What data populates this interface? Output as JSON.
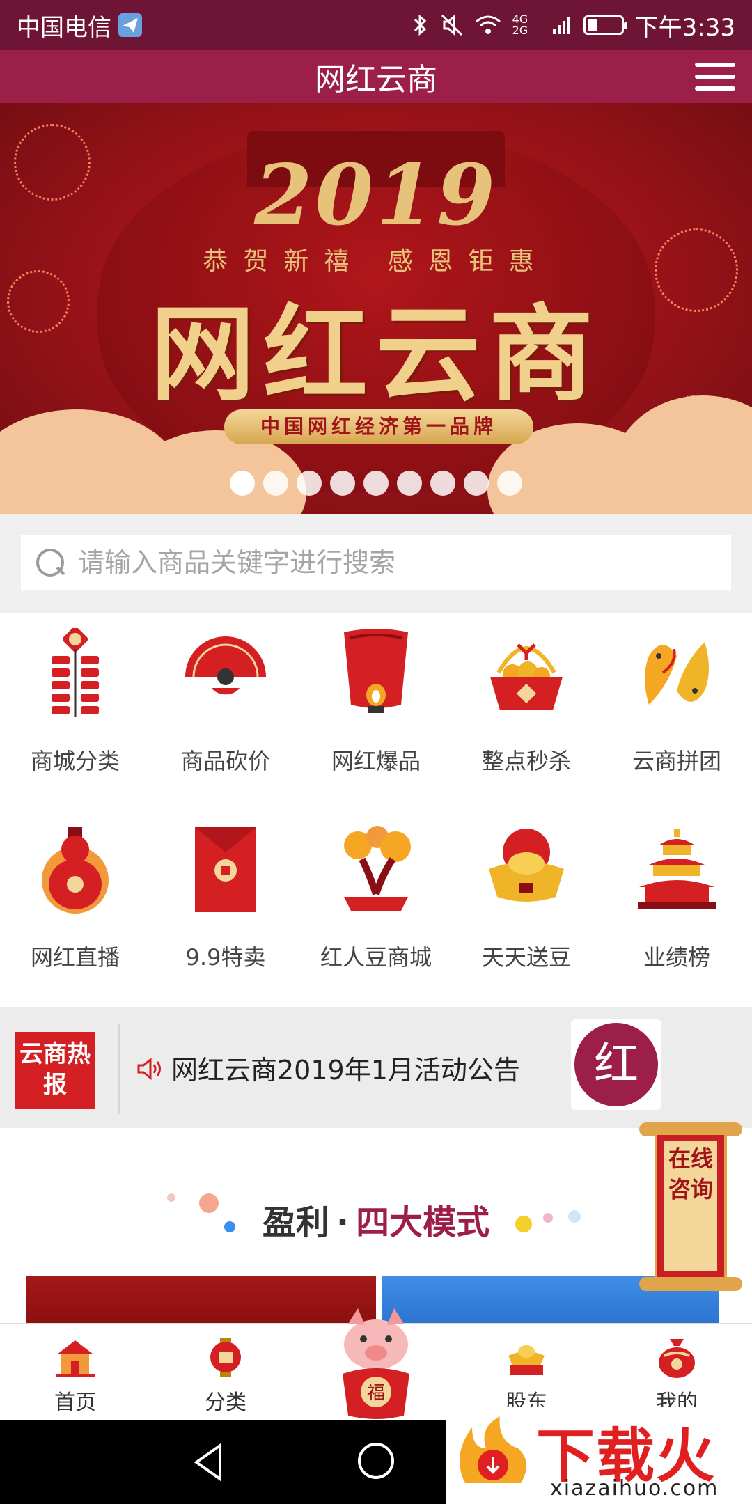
{
  "status_bar": {
    "carrier": "中国电信",
    "network": "4G 2G",
    "time": "下午3:33",
    "battery_percent": 30
  },
  "header": {
    "title": "网红云商"
  },
  "banner": {
    "year": "2019",
    "subtitle": "恭贺新禧  感恩钜惠",
    "title": "网红云商",
    "tagline": "中国网红经济第一品牌",
    "slide_count": 9,
    "active_index": 0
  },
  "search": {
    "placeholder": "请输入商品关键字进行搜索"
  },
  "categories": [
    {
      "label": "商城分类",
      "icon": "firecracker-icon"
    },
    {
      "label": "商品砍价",
      "icon": "fan-icon"
    },
    {
      "label": "网红爆品",
      "icon": "sky-lantern-icon"
    },
    {
      "label": "整点秒杀",
      "icon": "fruit-basket-icon"
    },
    {
      "label": "云商拼团",
      "icon": "koi-fish-icon"
    },
    {
      "label": "网红直播",
      "icon": "gourd-icon"
    },
    {
      "label": "9.9特卖",
      "icon": "red-envelope-icon"
    },
    {
      "label": "红人豆商城",
      "icon": "bonsai-tree-icon"
    },
    {
      "label": "天天送豆",
      "icon": "gold-ingot-icon"
    },
    {
      "label": "业绩榜",
      "icon": "temple-icon"
    }
  ],
  "notice": {
    "badge": "云商热报",
    "text": "网红云商2019年1月活动公告",
    "logo_char": "红"
  },
  "section": {
    "title_a": "盈利",
    "title_sep": "·",
    "title_b": "四大模式"
  },
  "consult": {
    "label": "在线咨询"
  },
  "bottom_nav": [
    {
      "label": "首页",
      "icon": "home-icon"
    },
    {
      "label": "分类",
      "icon": "lantern-icon"
    },
    {
      "label": "",
      "icon": "lucky-pig-icon"
    },
    {
      "label": "股东",
      "icon": "ingot-icon"
    },
    {
      "label": "我的",
      "icon": "lucky-bag-icon"
    }
  ],
  "watermark": {
    "brand": "下载火",
    "url": "xiazaihuo.com"
  },
  "colors": {
    "brand": "#9c1f4a",
    "status_bar": "#6e1434",
    "banner_red": "#a0141a",
    "gold": "#e7c27a"
  }
}
